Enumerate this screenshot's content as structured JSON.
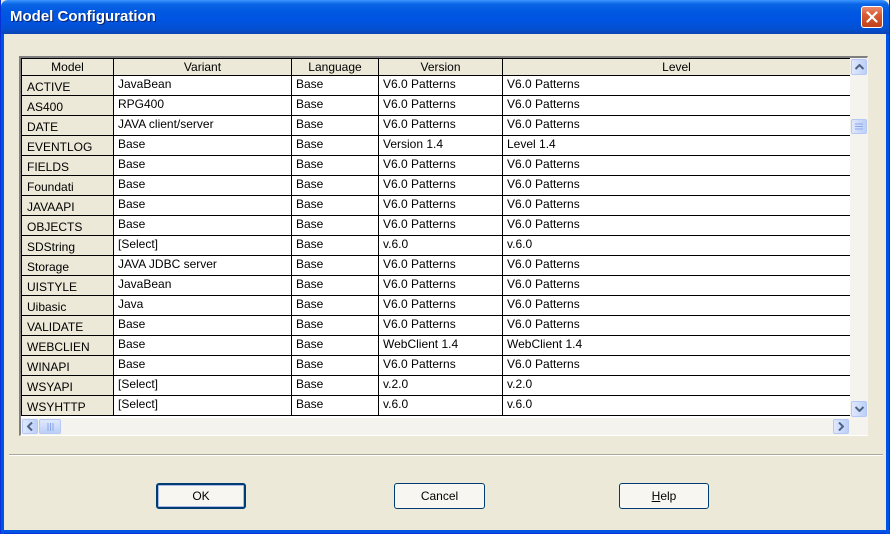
{
  "window": {
    "title": "Model Configuration"
  },
  "grid": {
    "columns": [
      "Model",
      "Variant",
      "Language",
      "Version",
      "Level"
    ],
    "rows": [
      [
        "ACTIVE",
        "JavaBean",
        "Base",
        "V6.0 Patterns",
        "V6.0 Patterns"
      ],
      [
        "AS400",
        "RPG400",
        "Base",
        "V6.0 Patterns",
        "V6.0 Patterns"
      ],
      [
        "DATE",
        "JAVA client/server",
        "Base",
        "V6.0 Patterns",
        "V6.0 Patterns"
      ],
      [
        "EVENTLOG",
        "Base",
        "Base",
        "Version 1.4",
        "Level 1.4"
      ],
      [
        "FIELDS",
        "Base",
        "Base",
        "V6.0 Patterns",
        "V6.0 Patterns"
      ],
      [
        "Foundati",
        "Base",
        "Base",
        "V6.0 Patterns",
        "V6.0 Patterns"
      ],
      [
        "JAVAAPI",
        "Base",
        "Base",
        "V6.0 Patterns",
        "V6.0 Patterns"
      ],
      [
        "OBJECTS",
        "Base",
        "Base",
        "V6.0 Patterns",
        "V6.0 Patterns"
      ],
      [
        "SDString",
        "[Select]",
        "Base",
        "v.6.0",
        "v.6.0"
      ],
      [
        "Storage",
        "JAVA JDBC server",
        "Base",
        "V6.0 Patterns",
        "V6.0 Patterns"
      ],
      [
        "UISTYLE",
        "JavaBean",
        "Base",
        "V6.0 Patterns",
        "V6.0 Patterns"
      ],
      [
        "Uibasic",
        "Java",
        "Base",
        "V6.0 Patterns",
        "V6.0 Patterns"
      ],
      [
        "VALIDATE",
        "Base",
        "Base",
        "V6.0 Patterns",
        "V6.0 Patterns"
      ],
      [
        "WEBCLIEN",
        "Base",
        "Base",
        "WebClient 1.4",
        "WebClient 1.4"
      ],
      [
        "WINAPI",
        "Base",
        "Base",
        "V6.0 Patterns",
        "V6.0 Patterns"
      ],
      [
        "WSYAPI",
        "[Select]",
        "Base",
        "v.2.0",
        "v.2.0"
      ],
      [
        "WSYHTTP",
        "[Select]",
        "Base",
        "v.6.0",
        "v.6.0"
      ]
    ]
  },
  "buttons": {
    "ok": "OK",
    "cancel": "Cancel",
    "help_mnemonic": "H",
    "help_rest": "elp"
  },
  "icons": {
    "close": "close-icon",
    "scroll_up": "chevron-up-icon",
    "scroll_down": "chevron-down-icon",
    "scroll_left": "chevron-left-icon",
    "scroll_right": "chevron-right-icon"
  },
  "colors": {
    "titlebar": "#0054e3",
    "dialog_bg": "#ece9d8",
    "close_button": "#d85a33"
  }
}
